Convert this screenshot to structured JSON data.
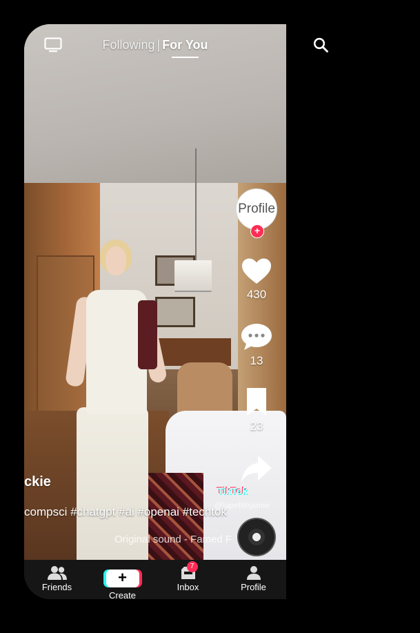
{
  "header": {
    "tab_following": "Following",
    "separator": "|",
    "tab_for_you": "For You"
  },
  "icons": {
    "live": "tv-icon",
    "search": "search-icon"
  },
  "creator": {
    "avatar_alt": "Profile",
    "follow": "+",
    "username": "ckie"
  },
  "actions": {
    "likes": "430",
    "comments": "13",
    "saves": "23"
  },
  "video": {
    "caption": "compsci #chatgpt #ai #openai #techtok",
    "sound": "Original sound - Famed F",
    "watermark": "TikTok",
    "watermark_handle": "@lapetitejamie"
  },
  "nav": {
    "friends": "Friends",
    "create": "Create",
    "create_symbol": "+",
    "inbox": "Inbox",
    "inbox_badge": "7",
    "profile": "Profile"
  },
  "colors": {
    "accent_red": "#fe2c55",
    "accent_cyan": "#25f4ee",
    "nav_background": "#161616"
  }
}
